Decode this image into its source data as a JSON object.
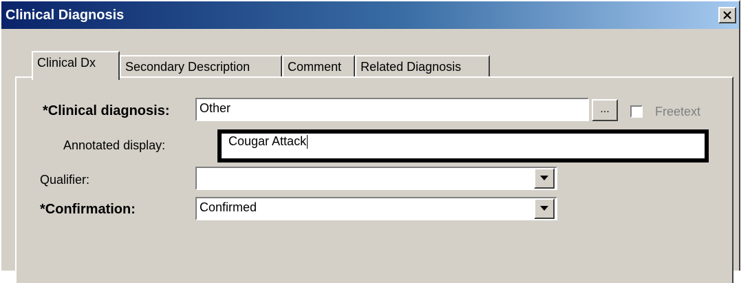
{
  "window": {
    "title": "Clinical Diagnosis",
    "close_icon": "close-icon"
  },
  "tabs": [
    {
      "label": "Clinical Dx",
      "active": true
    },
    {
      "label": "Secondary Description",
      "active": false
    },
    {
      "label": "Comment",
      "active": false
    },
    {
      "label": "Related Diagnosis",
      "active": false
    }
  ],
  "form": {
    "clinical_diagnosis": {
      "label": "*Clinical diagnosis:",
      "value": "Other",
      "browse_label": "...",
      "freetext_label": "Freetext",
      "freetext_checked": false
    },
    "annotated_display": {
      "label": "Annotated display:",
      "value": "Cougar Attack"
    },
    "qualifier": {
      "label": "Qualifier:",
      "value": ""
    },
    "confirmation": {
      "label": "*Confirmation:",
      "value": "Confirmed"
    }
  }
}
